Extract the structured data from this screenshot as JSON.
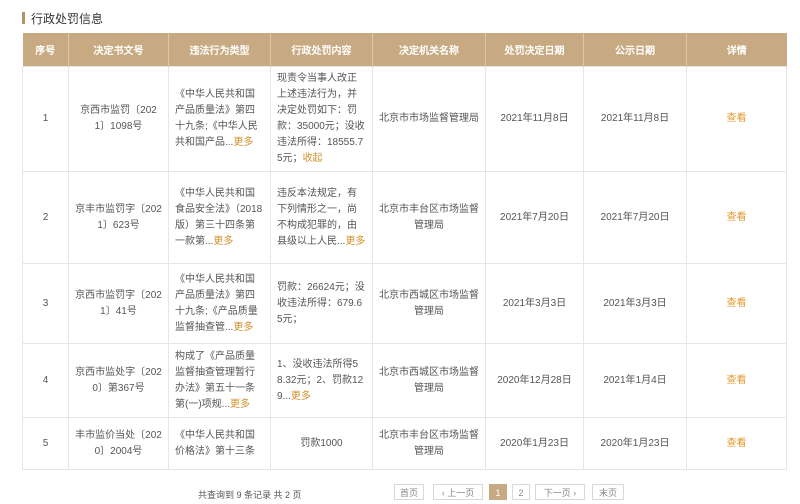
{
  "section": {
    "title": "行政处罚信息"
  },
  "table": {
    "headers": [
      "序号",
      "决定书文号",
      "违法行为类型",
      "行政处罚内容",
      "决定机关名称",
      "处罚决定日期",
      "公示日期",
      "详情"
    ],
    "rows": [
      {
        "index": "1",
        "doc_no": "京西市监罚〔2021〕1098号",
        "violation": "《中华人民共和国产品质量法》第四十九条;《中华人民共和国产品...",
        "violation_more": "更多",
        "content": "现责令当事人改正上述违法行为，并决定处罚如下：罚款：35000元；没收违法所得：18555.75元；",
        "content_more": "收起",
        "authority": "北京市市场监督管理局",
        "decision_date": "2021年11月8日",
        "publish_date": "2021年11月8日",
        "detail": "查看"
      },
      {
        "index": "2",
        "doc_no": "京丰市监罚字〔2021〕623号",
        "violation": "《中华人民共和国食品安全法》（2018版）第三十四条第一款第...",
        "violation_more": "更多",
        "content": "违反本法规定，有下列情形之一，尚不构成犯罪的，由县级以上人民...",
        "content_more": "更多",
        "authority": "北京市丰台区市场监督管理局",
        "decision_date": "2021年7月20日",
        "publish_date": "2021年7月20日",
        "detail": "查看"
      },
      {
        "index": "3",
        "doc_no": "京西市监罚字〔2021〕41号",
        "violation": "《中华人民共和国产品质量法》第四十九条;《产品质量监督抽查管...",
        "violation_more": "更多",
        "content": "罚款：26624元；没收违法所得：679.65元；",
        "content_more": "",
        "authority": "北京市西城区市场监督管理局",
        "decision_date": "2021年3月3日",
        "publish_date": "2021年3月3日",
        "detail": "查看"
      },
      {
        "index": "4",
        "doc_no": "京西市监处字〔2020〕第367号",
        "violation": "构成了《产品质量监督抽查管理暂行办法》第五十一条第(一)项规...",
        "violation_more": "更多",
        "content": "1、没收违法所得58.32元；2、罚款129...",
        "content_more": "更多",
        "authority": "北京市西城区市场监督管理局",
        "decision_date": "2020年12月28日",
        "publish_date": "2021年1月4日",
        "detail": "查看"
      },
      {
        "index": "5",
        "doc_no": "丰市监价当处〔2020〕2004号",
        "violation": "《中华人民共和国价格法》第十三条",
        "violation_more": "",
        "content": "罚款1000",
        "content_more": "",
        "authority": "北京市丰台区市场监督管理局",
        "decision_date": "2020年1月23日",
        "publish_date": "2020年1月23日",
        "detail": "查看"
      }
    ]
  },
  "pagination": {
    "summary": "共查询到 9 条记录 共 2 页",
    "first": "首页",
    "prev": "‹ 上一页",
    "pages": [
      "1",
      "2"
    ],
    "current": "1",
    "next": "下一页 ›",
    "last": "末页"
  },
  "colors": {
    "header_bg": "#c8aa82",
    "link": "#e39a2d",
    "title_bar": "#b4936a"
  }
}
